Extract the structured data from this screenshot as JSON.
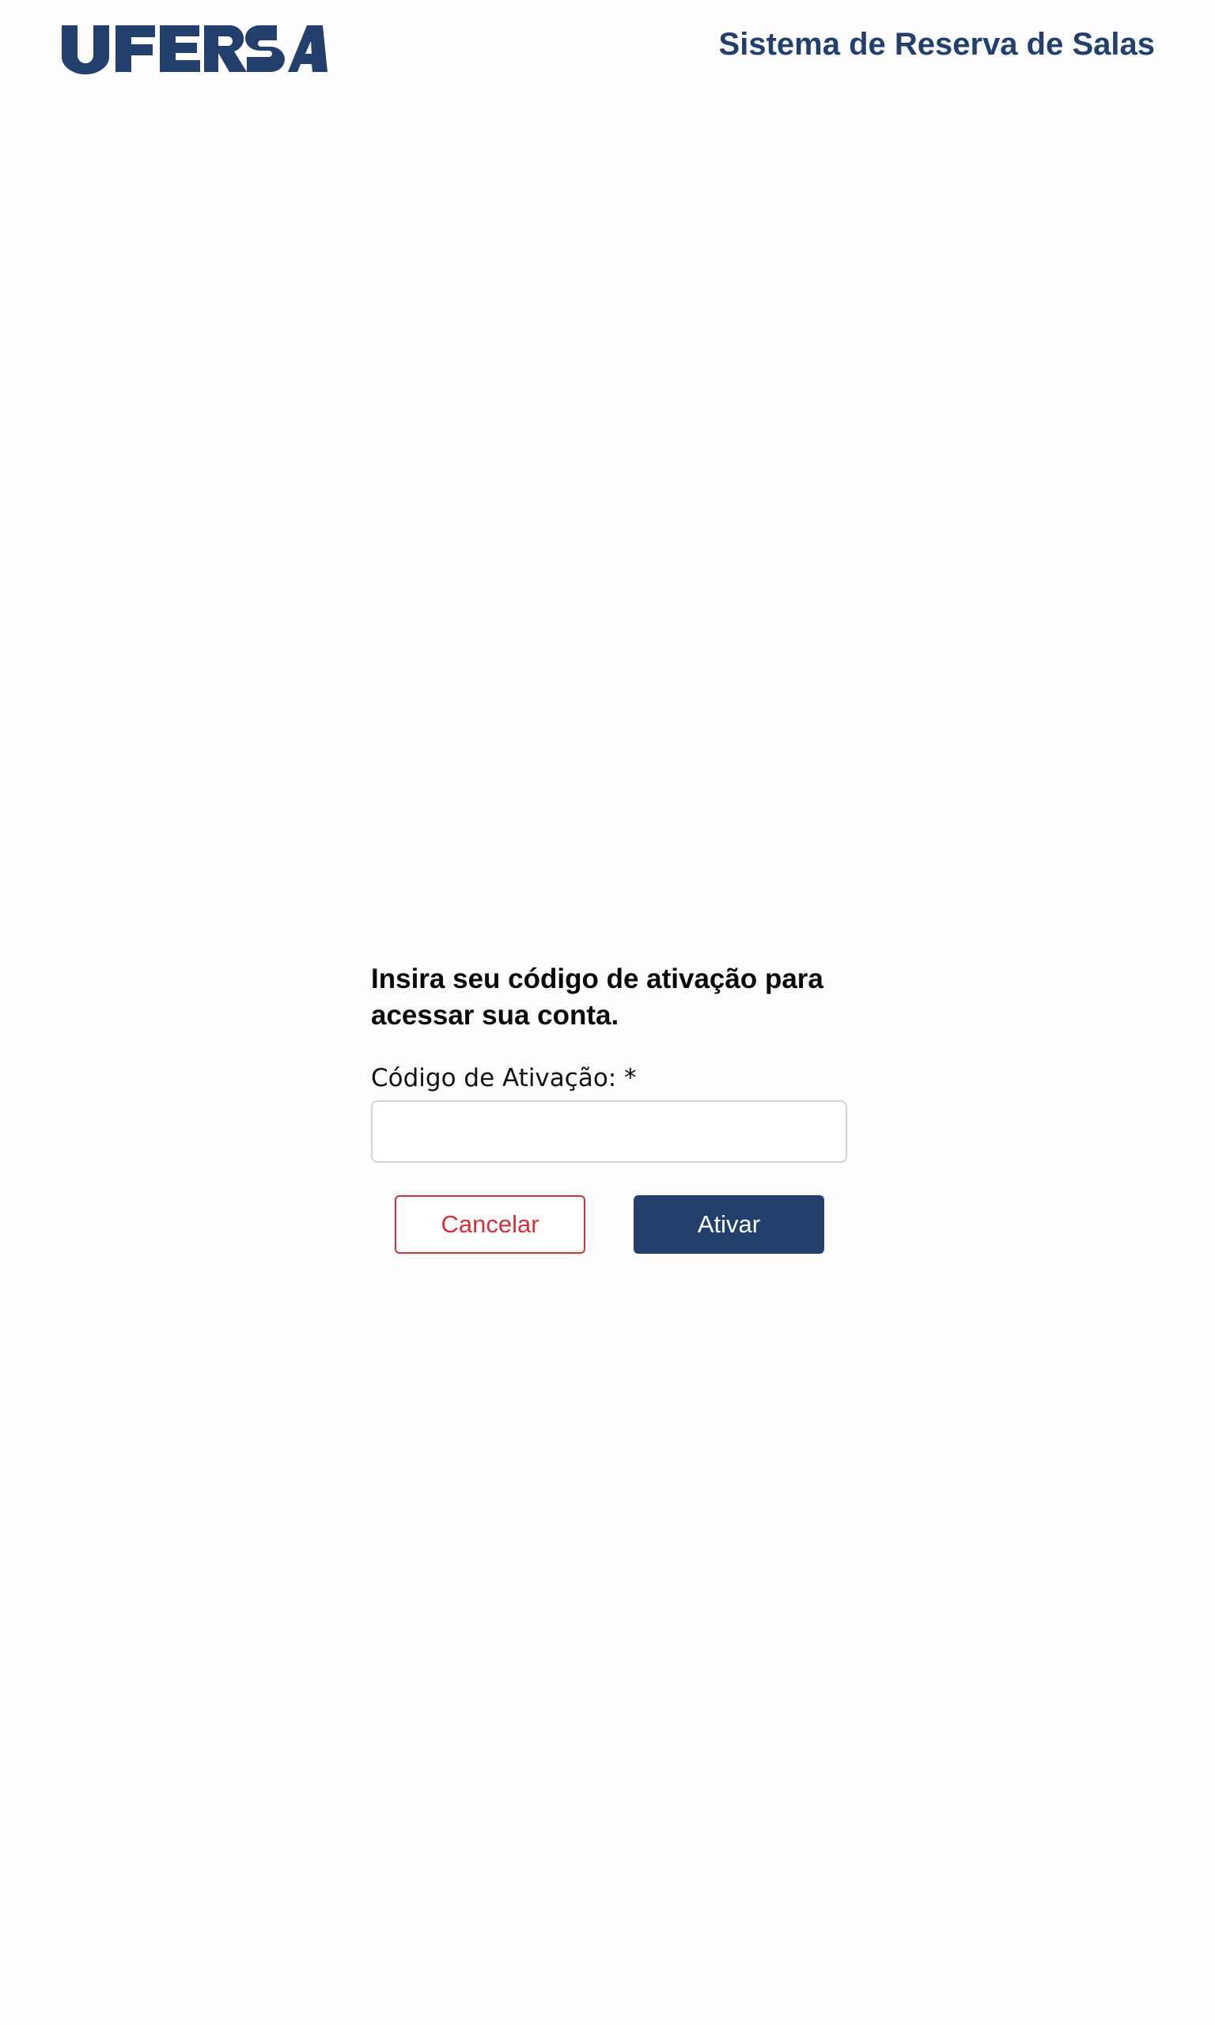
{
  "header": {
    "logo_text": "UFERSA",
    "system_title": "Sistema de Reserva de Salas"
  },
  "form": {
    "heading": "Insira seu código de ativação para acessar sua conta.",
    "code_label": "Código de Ativação: *",
    "code_value": "",
    "code_placeholder": "",
    "cancel_label": "Cancelar",
    "activate_label": "Ativar"
  },
  "colors": {
    "brand_navy": "#233f6b",
    "cancel_red": "#d0313b",
    "background": "#fdfdfd"
  }
}
